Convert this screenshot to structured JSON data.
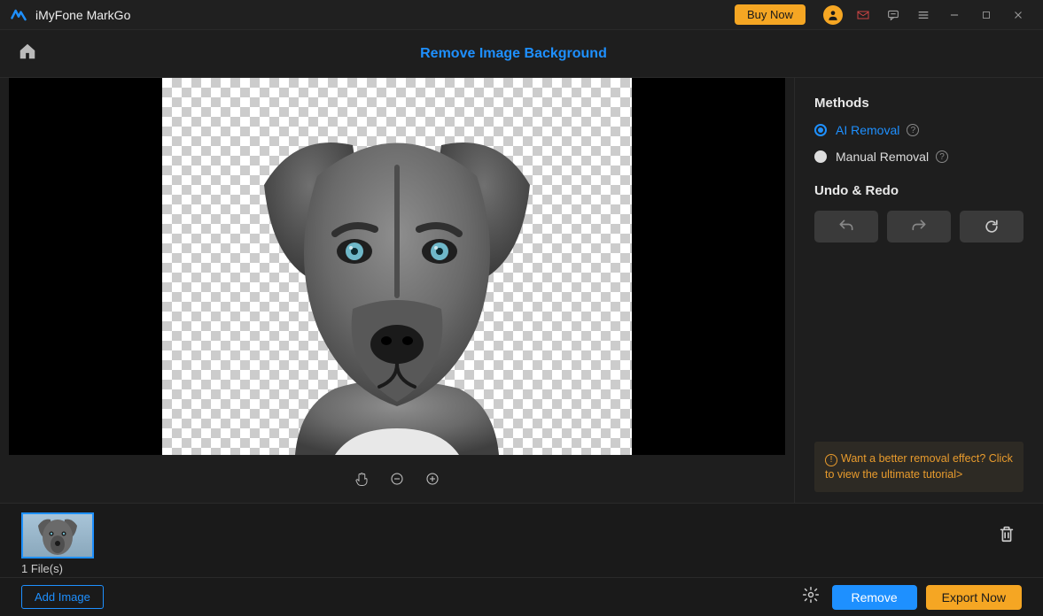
{
  "titlebar": {
    "app_name": "iMyFone MarkGo",
    "buy_now": "Buy Now"
  },
  "toolbar": {
    "title": "Remove Image Background"
  },
  "sidebar": {
    "methods_title": "Methods",
    "option_ai": "AI Removal",
    "option_manual": "Manual Removal",
    "undo_title": "Undo & Redo",
    "tip_text": "Want a better removal effect? Click to view the ultimate tutorial>"
  },
  "bottom": {
    "file_count": "1 File(s)",
    "add_image": "Add Image",
    "remove": "Remove",
    "export": "Export Now"
  }
}
